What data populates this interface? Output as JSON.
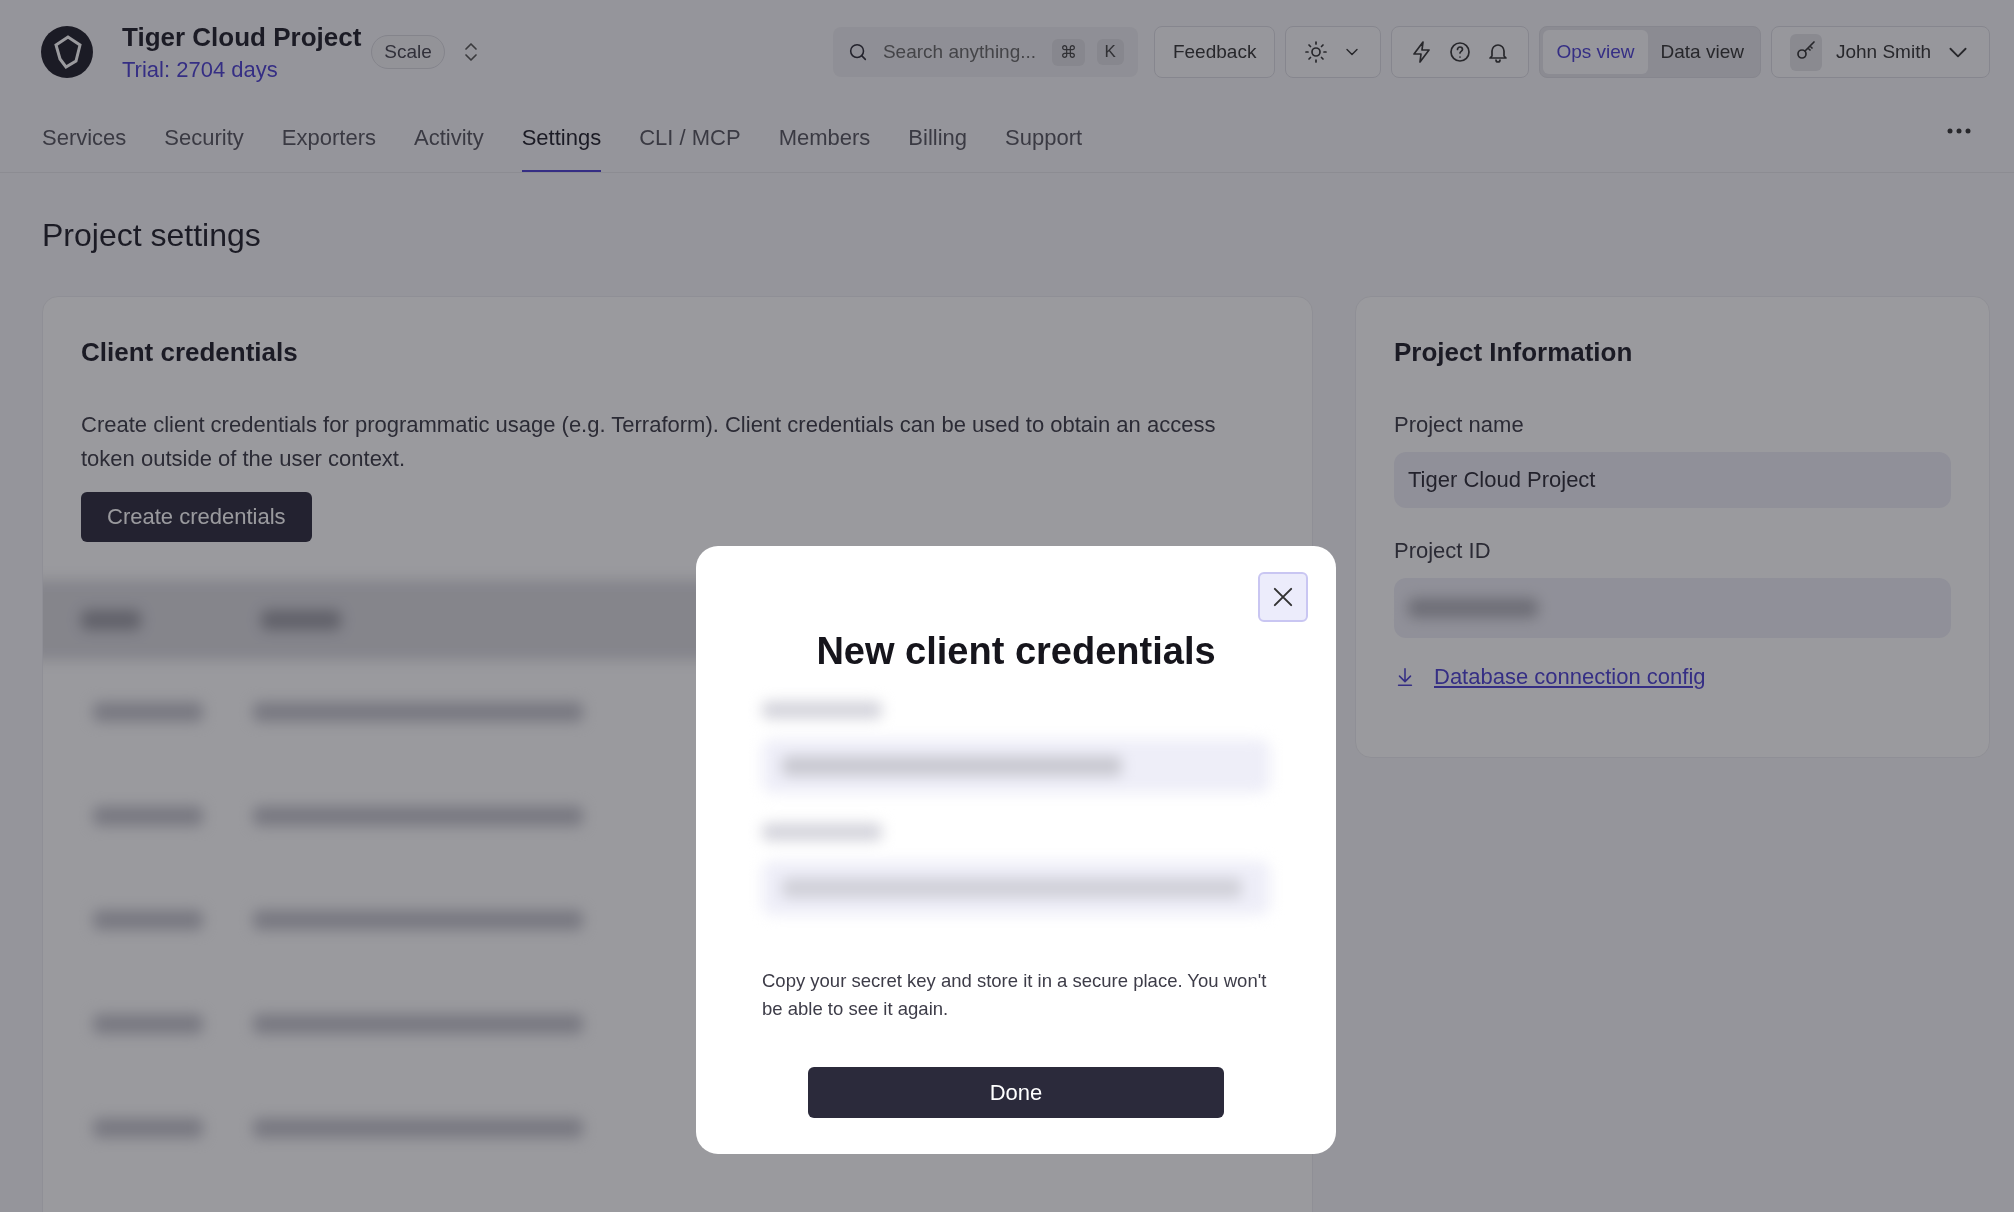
{
  "header": {
    "project_name": "Tiger Cloud Project",
    "trial": "Trial: 2704 days",
    "plan": "Scale",
    "search": {
      "placeholder": "Search anything...",
      "keys": [
        "⌘",
        "K"
      ]
    },
    "feedback": "Feedback",
    "views": [
      {
        "label": "Ops view",
        "selected": true
      },
      {
        "label": "Data view",
        "selected": false
      }
    ],
    "user": "John Smith"
  },
  "tabs": [
    {
      "label": "Services",
      "selected": false
    },
    {
      "label": "Security",
      "selected": false
    },
    {
      "label": "Exporters",
      "selected": false
    },
    {
      "label": "Activity",
      "selected": false
    },
    {
      "label": "Settings",
      "selected": true
    },
    {
      "label": "CLI / MCP",
      "selected": false
    },
    {
      "label": "Members",
      "selected": false
    },
    {
      "label": "Billing",
      "selected": false
    },
    {
      "label": "Support",
      "selected": false
    }
  ],
  "page_title": "Project settings",
  "credentials": {
    "title": "Client credentials",
    "description": "Create client credentials for programmatic usage (e.g. Terraform). Client credentials can be used to obtain an access token outside of the user context.",
    "button": "Create credentials"
  },
  "project_info": {
    "title": "Project Information",
    "fields": [
      {
        "label": "Project name",
        "value": "Tiger Cloud Project"
      },
      {
        "label": "Project ID"
      }
    ],
    "link": "Database connection config"
  },
  "modal": {
    "title": "New client credentials",
    "note": "Copy your secret key and store it in a secure place. You won't be able to see it again.",
    "button": "Done"
  }
}
